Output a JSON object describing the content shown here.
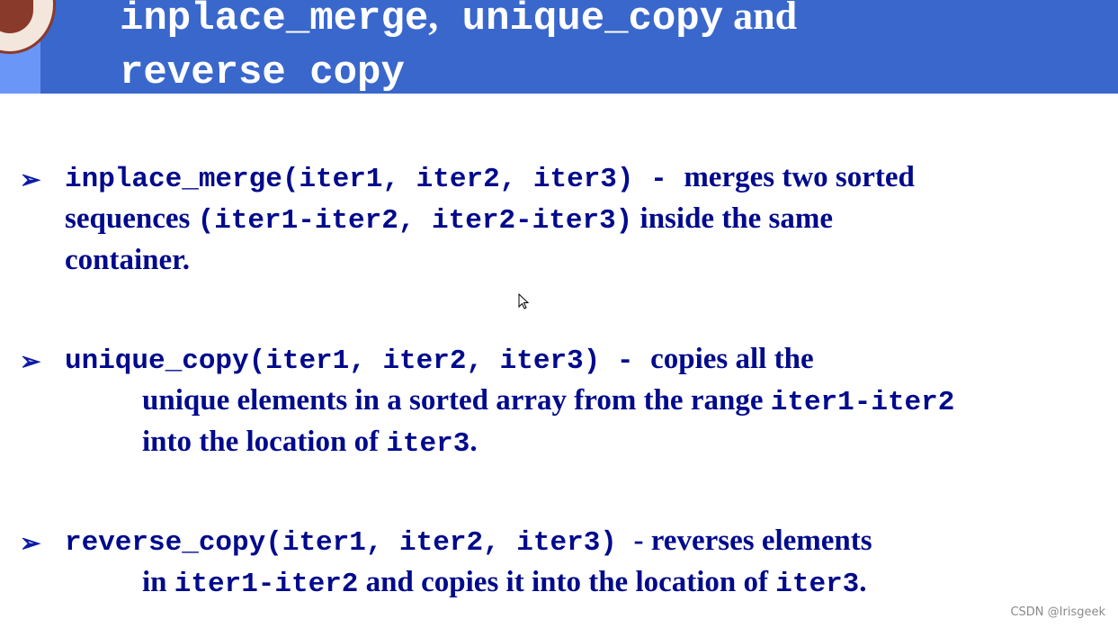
{
  "title": {
    "line1_mono": "inplace_merge",
    "line1_sep": ",",
    "line1_mono2": " unique_copy",
    "line1_and": " and",
    "line2": "reverse copy"
  },
  "items": [
    {
      "lines": [
        [
          {
            "t": "inplace_merge(iter1, iter2, iter3) - ",
            "m": true
          },
          {
            "t": "merges two sorted",
            "m": false
          }
        ],
        [
          {
            "t": "sequences ",
            "m": false
          },
          {
            "t": "(iter1-iter2, iter2-iter3)",
            "m": true
          },
          {
            "t": " inside  the same",
            "m": false
          }
        ],
        [
          {
            "t": "container.",
            "m": false
          }
        ]
      ]
    },
    {
      "lines": [
        [
          {
            "t": "unique_copy(iter1, iter2, iter3) - ",
            "m": true
          },
          {
            "t": "copies all the",
            "m": false
          }
        ],
        [
          {
            "t": "unique elements in a sorted array from the range ",
            "m": false
          },
          {
            "t": "iter1-iter2",
            "m": true
          }
        ],
        [
          {
            "t": "into the location of ",
            "m": false
          },
          {
            "t": "iter3",
            "m": true
          },
          {
            "t": ".",
            "m": false
          }
        ]
      ]
    },
    {
      "lines": [
        [
          {
            "t": "reverse_copy(iter1, iter2, iter3) ",
            "m": true
          },
          {
            "t": "- reverses elements",
            "m": false
          }
        ],
        [
          {
            "t": "in ",
            "m": false
          },
          {
            "t": "iter1-iter2",
            "m": true
          },
          {
            "t": " and copies it into the location of ",
            "m": false
          },
          {
            "t": "iter3",
            "m": true
          },
          {
            "t": ".",
            "m": false
          }
        ]
      ]
    }
  ],
  "bullet_icon": "arrow-bullet-icon",
  "watermark": "CSDN @Irisgeek",
  "colors": {
    "header": "#3a67cc",
    "header_light": "#6a96f8",
    "text": "#000a8c"
  }
}
